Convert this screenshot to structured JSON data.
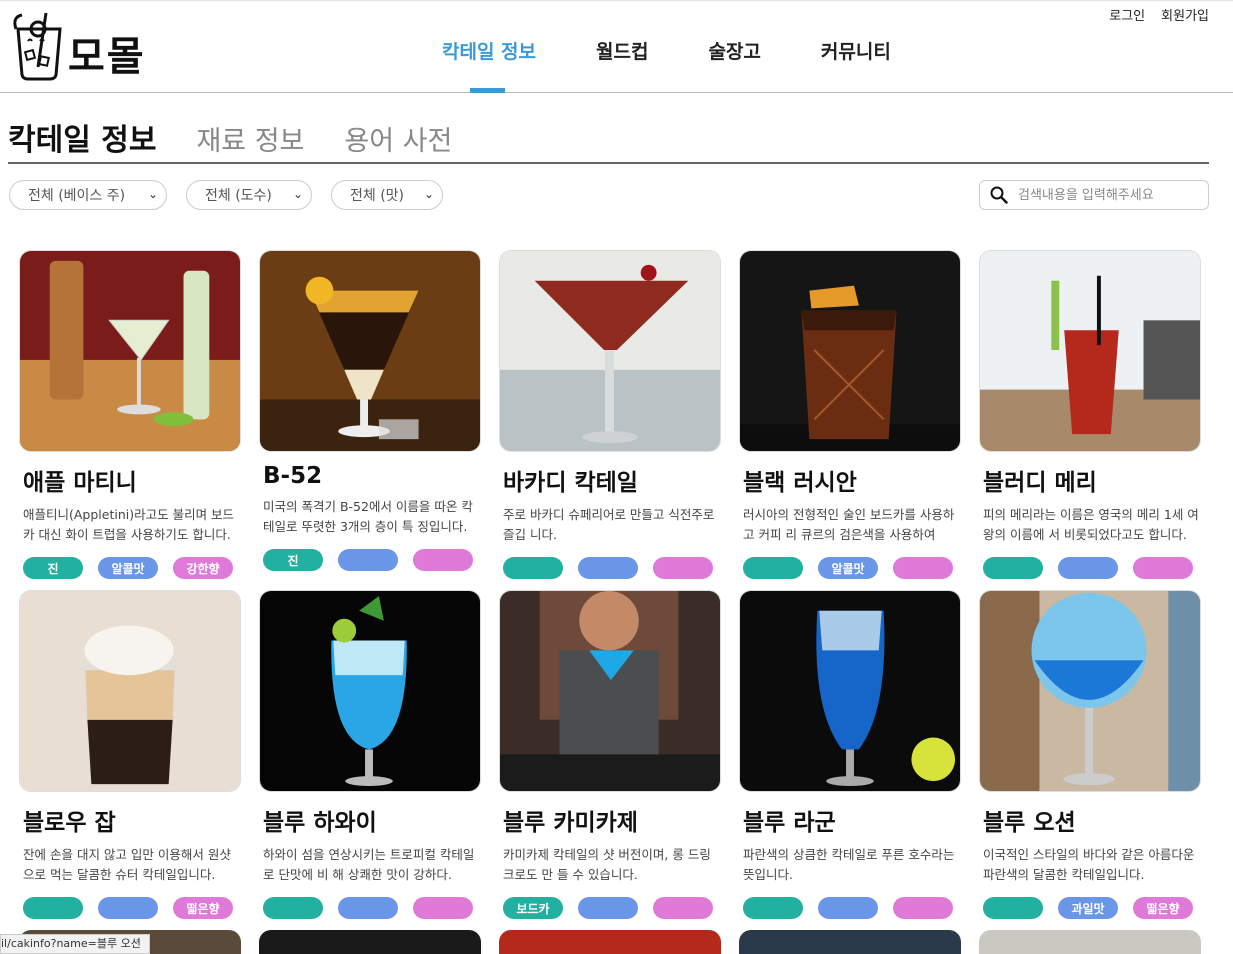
{
  "header": {
    "logo_text": "모몰",
    "auth": {
      "login": "로그인",
      "signup": "회원가입"
    },
    "nav": [
      {
        "label": "칵테일 정보",
        "active": true
      },
      {
        "label": "월드컵",
        "active": false
      },
      {
        "label": "술장고",
        "active": false
      },
      {
        "label": "커뮤니티",
        "active": false
      }
    ],
    "accent_color": "#3a9ad9"
  },
  "subtabs": [
    {
      "label": "칵테일 정보",
      "active": true
    },
    {
      "label": "재료 정보",
      "active": false
    },
    {
      "label": "용어 사전",
      "active": false
    }
  ],
  "filters": {
    "base": "전체 (베이스 주)",
    "abv": "전체 (도수)",
    "taste": "전체 (맛)"
  },
  "search": {
    "placeholder": "검색내용을 입력해주세요"
  },
  "cards": [
    {
      "title": "애플 마티니",
      "desc": "애플티니(Appletini)라고도 불리며 보드카 대신 화이 트럽을 사용하기도 합니다.",
      "tags": [
        "진",
        "알콜맛",
        "강한향"
      ]
    },
    {
      "title": "B-52",
      "desc": "미국의 폭격기 B-52에서 이름을 따온 칵테일로 뚜렷한 3개의 층이 특 징입니다. …",
      "tags": [
        "진",
        "",
        ""
      ]
    },
    {
      "title": "바카디 칵테일",
      "desc": "주로 바카디 슈페리어로 만들고 식전주로 즐깁 니다.",
      "tags": [
        "",
        "",
        ""
      ]
    },
    {
      "title": "블랙 러시안",
      "desc": "러시아의 전형적인 술인 보드카를 사용하고 커피 리 큐르의 검은색을 사용하여 그…",
      "tags": [
        "",
        "알콜맛",
        ""
      ]
    },
    {
      "title": "블러디 메리",
      "desc": "피의 메리라는 이름은 영국의 메리 1세 여왕의 이름에 서 비롯되었다고도 합니다.",
      "tags": [
        "",
        "",
        ""
      ]
    },
    {
      "title": "블로우 잡",
      "desc": "잔에 손을 대지 않고 입만 이용해서 원샷으로 먹는 달콤한 슈터 칵테일입니다.",
      "tags": [
        "",
        "",
        "떫은향"
      ]
    },
    {
      "title": "블루 하와이",
      "desc": "하와이 섬을 연상시키는 트로피컬 칵테일로 단맛에 비 해 상쾌한 맛이 강하다. 비…",
      "tags": [
        "",
        "",
        ""
      ]
    },
    {
      "title": "블루 카미카제",
      "desc": "카미카제 칵테일의 샷 버전이며, 롱 드링크로도 만 들 수 있습니다.",
      "tags": [
        "보드카",
        "",
        ""
      ]
    },
    {
      "title": "블루 라군",
      "desc": "파란색의 상큼한 칵테일로 푸른 호수라는 뜻입니다.",
      "tags": [
        "",
        "",
        ""
      ]
    },
    {
      "title": "블루 오션",
      "desc": "이국적인 스타일의 바다와 같은 아름다운 파란색의 달콤한 칵테일입니다.",
      "tags": [
        "",
        "과일맛",
        "떫은향"
      ]
    }
  ],
  "status_url": "il/cakinfo?name=블루 오션"
}
